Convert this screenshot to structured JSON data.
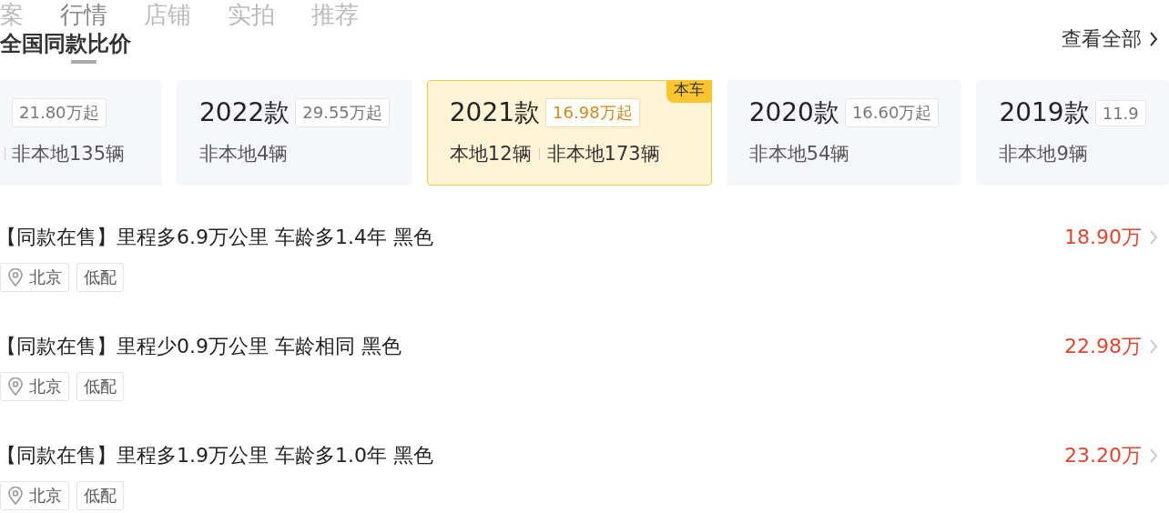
{
  "tabs": [
    {
      "label": "案",
      "selected": false
    },
    {
      "label": "行情",
      "selected": true
    },
    {
      "label": "店铺",
      "selected": false
    },
    {
      "label": "实拍",
      "selected": false
    },
    {
      "label": "推荐",
      "selected": false
    }
  ],
  "section": {
    "title": "全国同款比价",
    "view_all": "查看全部"
  },
  "cards": [
    {
      "kind": "cut-left",
      "price": "21.80万起",
      "nonlocal": "非本地135辆",
      "selected": false
    },
    {
      "kind": "full",
      "year": "2022款",
      "price": "29.55万起",
      "nonlocal": "非本地4辆",
      "selected": false
    },
    {
      "kind": "full",
      "year": "2021款",
      "price": "16.98万起",
      "local": "本地12辆",
      "nonlocal": "非本地173辆",
      "selected": true,
      "badge": "本车"
    },
    {
      "kind": "full",
      "year": "2020款",
      "price": "16.60万起",
      "nonlocal": "非本地54辆",
      "selected": false
    },
    {
      "kind": "full",
      "year": "2019款",
      "price": "11.9",
      "nonlocal": "非本地9辆",
      "selected": false
    }
  ],
  "listings": [
    {
      "title": "【同款在售】里程多6.9万公里 车龄多1.4年 黑色",
      "price": "18.90万",
      "location": "北京",
      "tag": "低配"
    },
    {
      "title": "【同款在售】里程少0.9万公里 车龄相同 黑色",
      "price": "22.98万",
      "location": "北京",
      "tag": "低配"
    },
    {
      "title": "【同款在售】里程多1.9万公里 车龄多1.0年 黑色",
      "price": "23.20万",
      "location": "北京",
      "tag": "低配"
    }
  ]
}
